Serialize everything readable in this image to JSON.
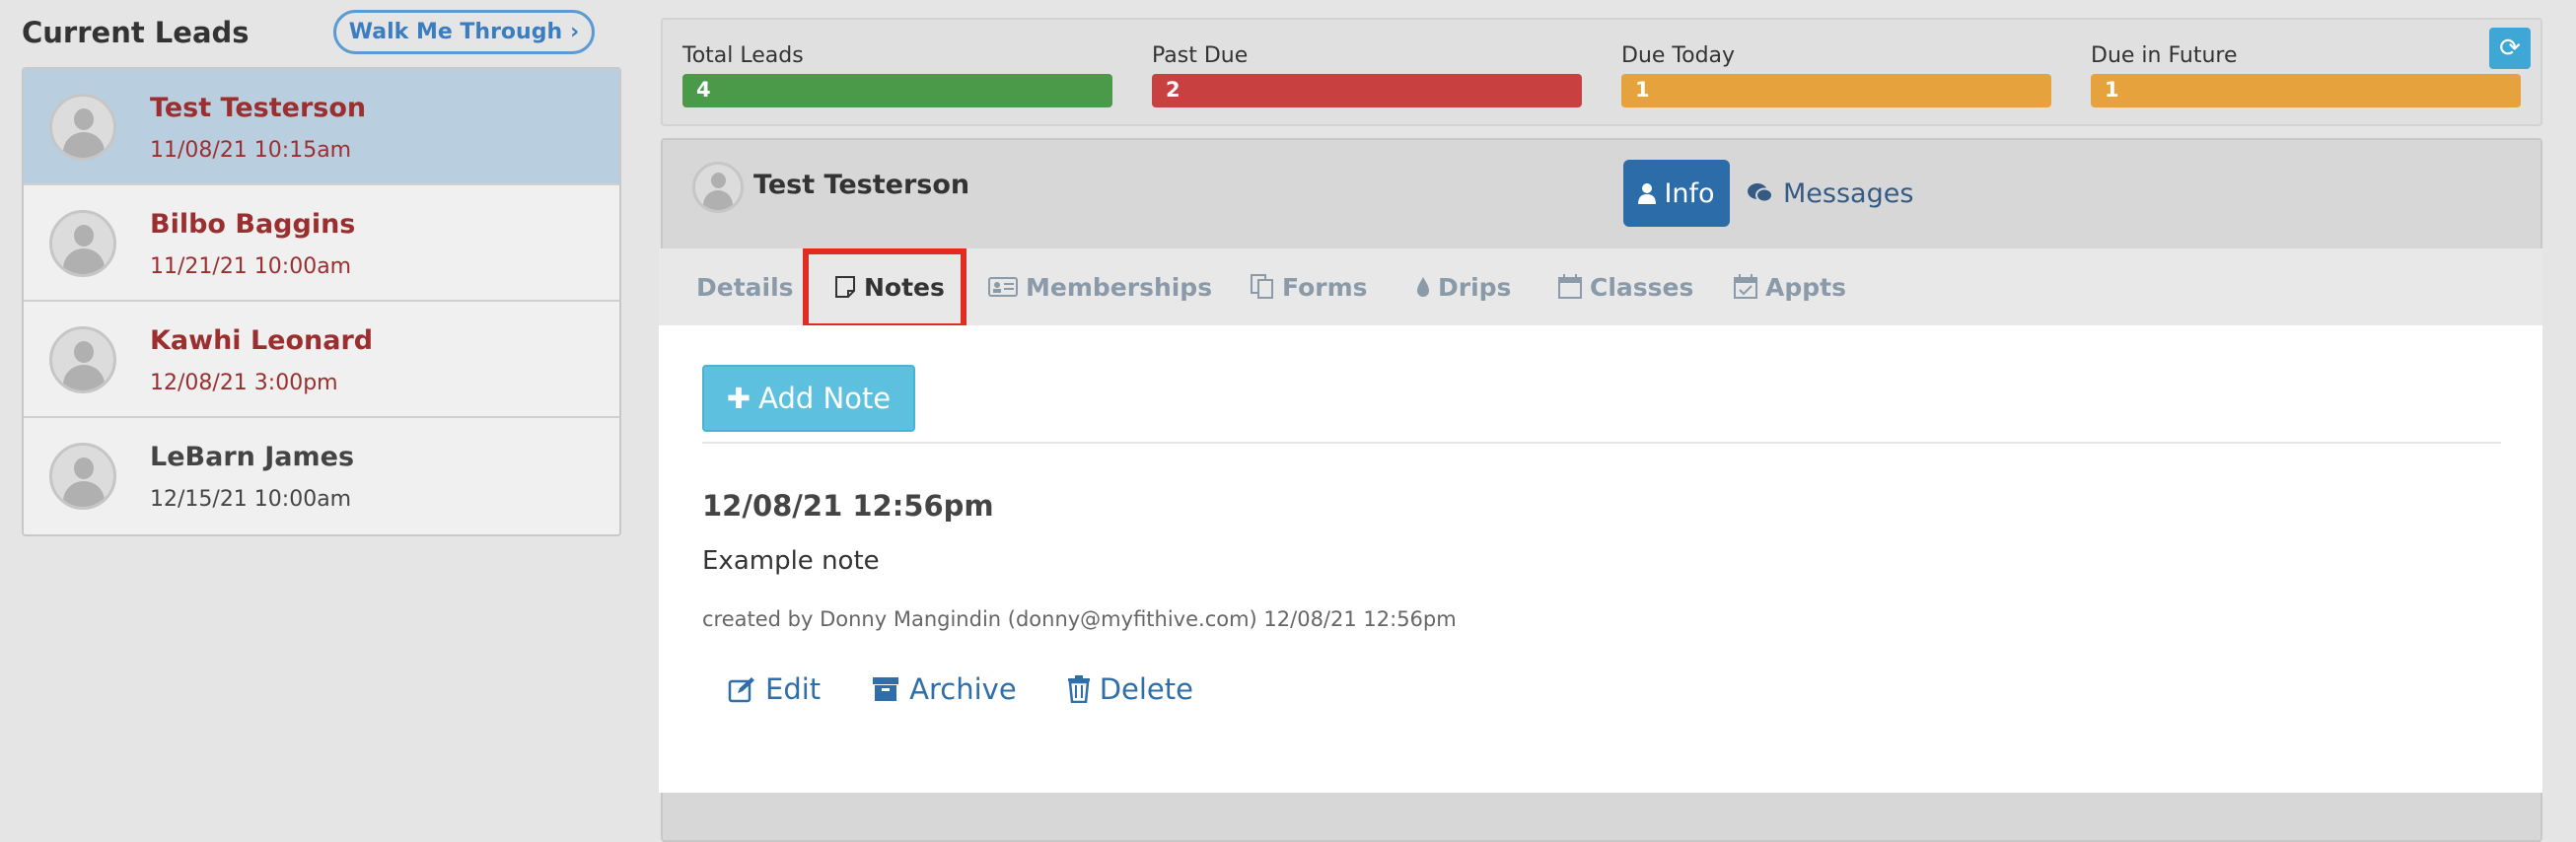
{
  "left": {
    "title": "Current Leads",
    "walk_button": "Walk Me Through"
  },
  "leads": [
    {
      "name": "Test Testerson",
      "date": "11/08/21 10:15am"
    },
    {
      "name": "Bilbo Baggins",
      "date": "11/21/21 10:00am"
    },
    {
      "name": "Kawhi Leonard",
      "date": "12/08/21 3:00pm"
    },
    {
      "name": "LeBarn James",
      "date": "12/15/21 10:00am"
    }
  ],
  "stats": [
    {
      "label": "Total Leads",
      "value": "4",
      "color": "#4a9a4a"
    },
    {
      "label": "Past Due",
      "value": "2",
      "color": "#c84040"
    },
    {
      "label": "Due Today",
      "value": "1",
      "color": "#e6a23c"
    },
    {
      "label": "Due in Future",
      "value": "1",
      "color": "#e6a23c"
    }
  ],
  "contact": {
    "name": "Test Testerson",
    "info_button": "Info",
    "messages_button": "Messages"
  },
  "tabs": [
    {
      "label": "Details",
      "icon": "none"
    },
    {
      "label": "Notes",
      "icon": "note-icon"
    },
    {
      "label": "Memberships",
      "icon": "id-card-icon"
    },
    {
      "label": "Forms",
      "icon": "files-icon"
    },
    {
      "label": "Drips",
      "icon": "drop-icon"
    },
    {
      "label": "Classes",
      "icon": "calendar-icon"
    },
    {
      "label": "Appts",
      "icon": "calendar-check-icon"
    }
  ],
  "notes": {
    "add_button": "Add Note",
    "items": [
      {
        "date": "12/08/21 12:56pm",
        "body": "Example note",
        "meta": "created by Donny Mangindin (donny@myfithive.com) 12/08/21 12:56pm",
        "edit": "Edit",
        "archive": "Archive",
        "delete": "Delete"
      }
    ]
  }
}
